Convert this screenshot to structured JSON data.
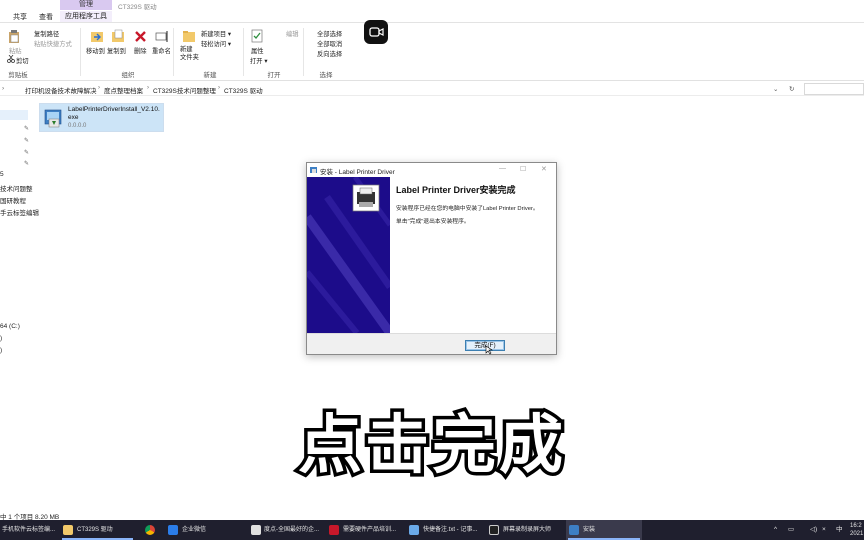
{
  "titlebar": {
    "manage_tab": "管理",
    "path_title": "CT329S 驱动"
  },
  "tabs": {
    "share": "共享",
    "view": "查看",
    "app_tools": "应用程序工具"
  },
  "ribbon": {
    "clipboard": {
      "paste": "粘贴",
      "copy_path": "复制路径",
      "paste_shortcut": "粘贴快捷方式",
      "cut": "剪切",
      "label": "剪贴板"
    },
    "organize": {
      "move_to": "移动到",
      "copy_to": "复制到",
      "delete": "删除",
      "rename": "重命名",
      "label": "组织"
    },
    "new": {
      "new_folder": "新建\n文件夹",
      "new_item": "新建项目 ▾",
      "easy_access": "轻松访问 ▾",
      "label": "新建"
    },
    "open": {
      "properties": "属性",
      "open": "打开 ▾",
      "edit": "编辑",
      "label": "打开"
    },
    "select": {
      "select_all": "全部选择",
      "select_none": "全部取消",
      "invert": "反向选择",
      "label": "选择"
    }
  },
  "address": {
    "crumbs": [
      "打印机设备技术故障解决",
      "度点整理档案",
      "CT329S技术问题整理",
      "CT329S 驱动"
    ]
  },
  "sidebar": {
    "items": [
      "5",
      "技术问题整",
      "国研教程",
      "手云标签编辑",
      "64 (C:)",
      ")",
      ")"
    ]
  },
  "file": {
    "name": "LabelPrinterDriverInstall_V2.10.exe",
    "version": "0.0.0.0"
  },
  "status": {
    "text": "中 1 个项目  8.20 MB"
  },
  "dialog": {
    "title": "安装 - Label Printer Driver",
    "heading": "Label Printer Driver安装完成",
    "line1": "安装程序已经在您的电脑中安装了Label Printer Driver。",
    "line2": "单击\"完成\"退出本安装程序。",
    "finish_button": "完成(F)",
    "colors": {
      "banner": "#1c0c8a"
    }
  },
  "subtitle": "点击完成",
  "taskbar": {
    "items": [
      "手机软件云标签编...",
      "CT329S 驱动",
      "企业微信",
      "度点-全国最好的企...",
      "需要硬件产品培训...",
      "快捷备注.txt - 记事...",
      "屏幕录制录屏大师",
      "安装"
    ],
    "tray": {
      "ime": "中",
      "time": "16:2",
      "date": "2021"
    }
  }
}
